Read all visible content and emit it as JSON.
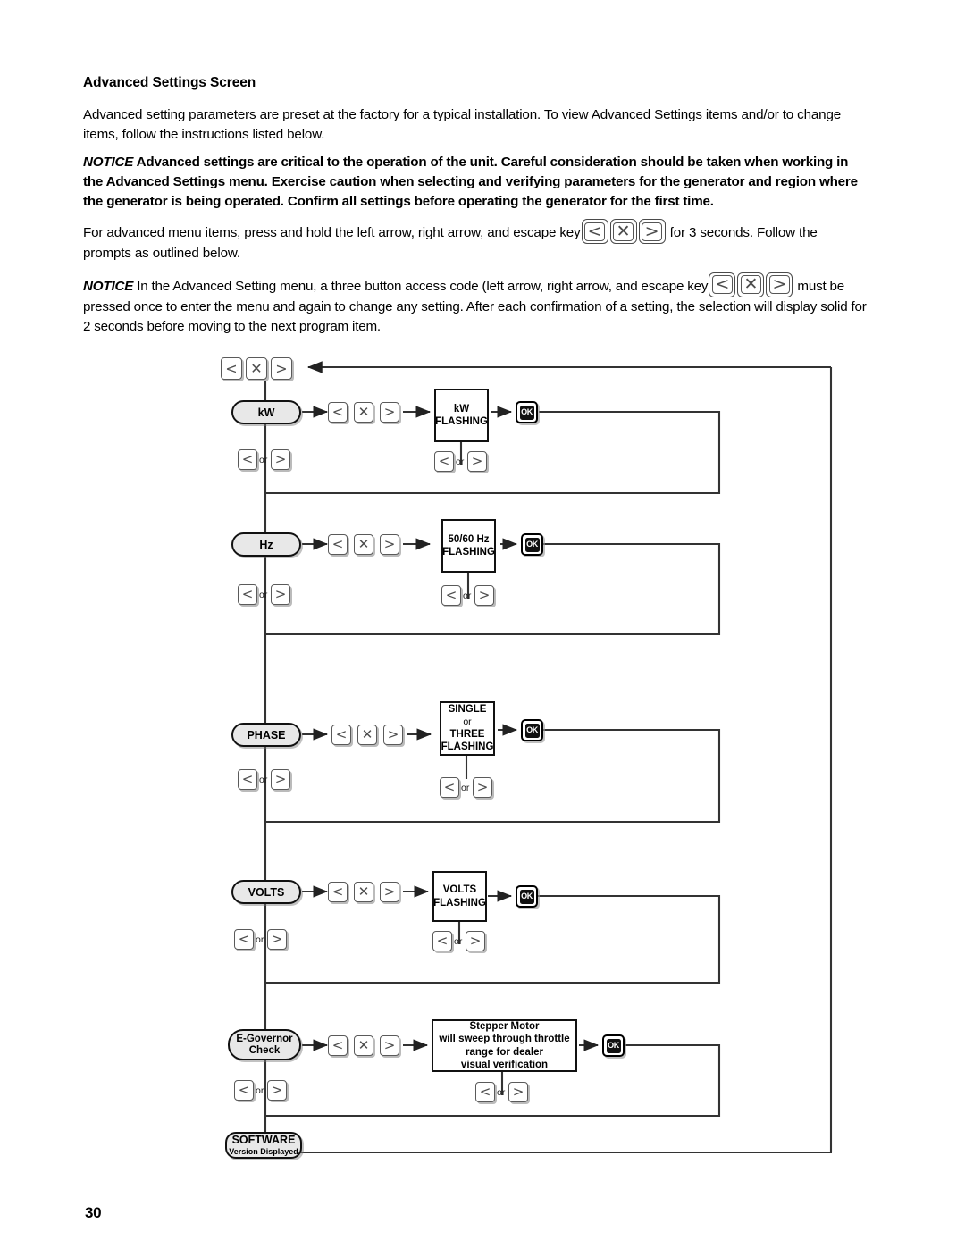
{
  "document": {
    "section_title": "Advanced Settings Screen",
    "page_number": "30",
    "paragraphs": {
      "intro": "Advanced setting parameters are preset at the factory for a typical installation. To view Advanced Settings items and/or to change items, follow the instructions listed below.",
      "notice_label": "NOTICE",
      "notice_1": "Advanced settings are critical to the operation of the unit. Careful consideration should be taken when working in the Advanced Settings menu. Exercise caution when selecting and verifying parameters for the generator and region where the generator is being operated. Confirm all settings before operating the generator for the first time.",
      "instr_pre": "For advanced menu items, press and hold the left arrow, right arrow, and escape key",
      "instr_post": "for 3 seconds. Follow the prompts as outlined below.",
      "notice_2_pre": "In the Advanced Setting menu, a three button access code (left arrow, right arrow, and escape key",
      "notice_2_post": "must be pressed once to enter the menu and again to change any setting. After each confirmation of a setting, the selection will display solid for 2 seconds before moving to the next program item."
    }
  },
  "keys": {
    "left_arrow": "<",
    "escape": "✕",
    "right_arrow": ">",
    "ok": "OK",
    "or": "or"
  },
  "flowchart": {
    "rows": [
      {
        "id": "kw",
        "node_label": "kW",
        "display_lines": [
          "kW",
          "FLASHING"
        ],
        "confirm": "OK"
      },
      {
        "id": "hz",
        "node_label": "Hz",
        "display_lines": [
          "50/60 Hz",
          "FLASHING"
        ],
        "confirm": "OK"
      },
      {
        "id": "phase",
        "node_label": "PHASE",
        "display_lines": [
          "SINGLE",
          "or",
          "THREE",
          "FLASHING"
        ],
        "confirm": "OK"
      },
      {
        "id": "volts",
        "node_label": "VOLTS",
        "display_lines": [
          "VOLTS",
          "FLASHING"
        ],
        "confirm": "OK"
      },
      {
        "id": "egovernor",
        "node_label_line1": "E-Governor",
        "node_label_line2": "Check",
        "display_lines": [
          "Stepper Motor",
          "will sweep through throttle",
          "range for dealer",
          "visual verification"
        ],
        "confirm": "OK"
      }
    ],
    "terminal": {
      "label": "SOFTWARE",
      "sub": "Version Displayed"
    }
  },
  "colors": {
    "line": "#333333",
    "node_fill": "#e8e8e8",
    "key_stroke": "#5a5a5a",
    "text": "#000000"
  }
}
